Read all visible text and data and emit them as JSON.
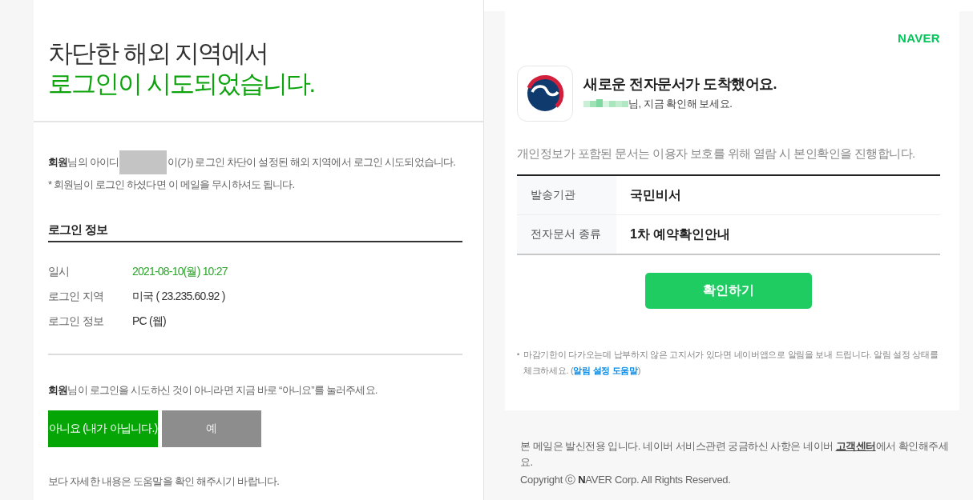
{
  "left_panel": {
    "title_lines": [
      {
        "text": "차단한 해외 지역에서",
        "highlight": false
      },
      {
        "text": "로그인이 시도되었습니다.",
        "highlight": true
      }
    ],
    "notice": {
      "before": "**회원**님의 아이디",
      "after": "이(가) 로그인 차단이 설정된 해외 지역에서 로그인 시도되었습니다."
    },
    "note": "* 회원님이 로그인 하셨다면 이 메일을 무시하셔도 됩니다.",
    "section_title": "로그인 정보",
    "info_rows": [
      {
        "label": "일시",
        "value": "2021-08-10(월) 10:27",
        "highlight": true
      },
      {
        "label": "로그인 지역",
        "value": "미국 ( 23.235.60.92 )",
        "highlight": false
      },
      {
        "label": "로그인 정보",
        "value": "PC (웹)",
        "highlight": false
      }
    ],
    "prompt": "**회원**님이 로그인을 시도하신 것이 아니라면 지금 바로 “아니요”를 눌러주세요.",
    "buttons": [
      {
        "label": "아니요 (내가 아닙니다.)",
        "kind": "primary"
      },
      {
        "label": "예",
        "kind": "secondary"
      }
    ],
    "help_text": "보다 자세한 내용은 도움말을 확인 해주시기 바랍니다."
  },
  "right_panel": {
    "logo": "NAVER",
    "heading": "새로운 전자문서가 도착했어요.",
    "subheading": "님, 지금 확인해 보세요.",
    "notice": "개인정보가 포함된 문서는 이용자 보호를 위해 열람 시 본인확인을 진행합니다.",
    "details": [
      {
        "label": "발송기관",
        "value": "국민비서"
      },
      {
        "label": "전자문서 종류",
        "value": "1차 예약확인안내"
      }
    ],
    "confirm_button": "확인하기",
    "footnote": {
      "bullet": "•",
      "text": "마감기한이 다가오는데 납부하지 않은 고지서가 있다면 네이버앱으로 알림을 보내 드립니다. 알림 설정 상태를 체크하세요. (",
      "link": "알림 설정 도움말",
      "text_after": ")"
    }
  },
  "footer": {
    "text_before": "본 메일은 발신전용 입니다. 네이버 서비스관련 궁금하신 사항은 네이버 ",
    "link": "고객센터",
    "text_after": "에서 확인해주세요.",
    "copyright": "Copyright ⓒ **N**AVER Corp. All Rights Reserved."
  }
}
